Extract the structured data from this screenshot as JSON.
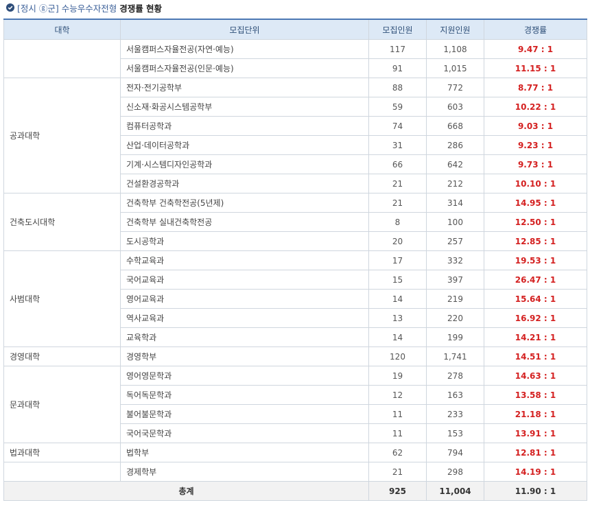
{
  "title": {
    "prefix": "[정시 ⓖ군] 수능우수자전형",
    "main": "경쟁률 현황"
  },
  "headers": [
    "대학",
    "모집단위",
    "모집인원",
    "지원인원",
    "경쟁률"
  ],
  "groups": [
    {
      "college": "",
      "rows": [
        {
          "unit": "서울캠퍼스자율전공(자연·예능)",
          "quota": "117",
          "applicants": "1,108",
          "rate": "9.47 : 1"
        },
        {
          "unit": "서울캠퍼스자율전공(인문·예능)",
          "quota": "91",
          "applicants": "1,015",
          "rate": "11.15 : 1"
        }
      ]
    },
    {
      "college": "공과대학",
      "rows": [
        {
          "unit": "전자·전기공학부",
          "quota": "88",
          "applicants": "772",
          "rate": "8.77 : 1"
        },
        {
          "unit": "신소재·화공시스템공학부",
          "quota": "59",
          "applicants": "603",
          "rate": "10.22 : 1"
        },
        {
          "unit": "컴퓨터공학과",
          "quota": "74",
          "applicants": "668",
          "rate": "9.03 : 1"
        },
        {
          "unit": "산업·데이터공학과",
          "quota": "31",
          "applicants": "286",
          "rate": "9.23 : 1"
        },
        {
          "unit": "기계·시스템디자인공학과",
          "quota": "66",
          "applicants": "642",
          "rate": "9.73 : 1"
        },
        {
          "unit": "건설환경공학과",
          "quota": "21",
          "applicants": "212",
          "rate": "10.10 : 1"
        }
      ]
    },
    {
      "college": "건축도시대학",
      "rows": [
        {
          "unit": "건축학부 건축학전공(5년제)",
          "quota": "21",
          "applicants": "314",
          "rate": "14.95 : 1"
        },
        {
          "unit": "건축학부 실내건축학전공",
          "quota": "8",
          "applicants": "100",
          "rate": "12.50 : 1"
        },
        {
          "unit": "도시공학과",
          "quota": "20",
          "applicants": "257",
          "rate": "12.85 : 1"
        }
      ]
    },
    {
      "college": "사범대학",
      "rows": [
        {
          "unit": "수학교육과",
          "quota": "17",
          "applicants": "332",
          "rate": "19.53 : 1"
        },
        {
          "unit": "국어교육과",
          "quota": "15",
          "applicants": "397",
          "rate": "26.47 : 1"
        },
        {
          "unit": "영어교육과",
          "quota": "14",
          "applicants": "219",
          "rate": "15.64 : 1"
        },
        {
          "unit": "역사교육과",
          "quota": "13",
          "applicants": "220",
          "rate": "16.92 : 1"
        },
        {
          "unit": "교육학과",
          "quota": "14",
          "applicants": "199",
          "rate": "14.21 : 1"
        }
      ]
    },
    {
      "college": "경영대학",
      "rows": [
        {
          "unit": "경영학부",
          "quota": "120",
          "applicants": "1,741",
          "rate": "14.51 : 1"
        }
      ]
    },
    {
      "college": "문과대학",
      "rows": [
        {
          "unit": "영어영문학과",
          "quota": "19",
          "applicants": "278",
          "rate": "14.63 : 1"
        },
        {
          "unit": "독어독문학과",
          "quota": "12",
          "applicants": "163",
          "rate": "13.58 : 1"
        },
        {
          "unit": "불어불문학과",
          "quota": "11",
          "applicants": "233",
          "rate": "21.18 : 1"
        },
        {
          "unit": "국어국문학과",
          "quota": "11",
          "applicants": "153",
          "rate": "13.91 : 1"
        }
      ]
    },
    {
      "college": "법과대학",
      "rows": [
        {
          "unit": "법학부",
          "quota": "62",
          "applicants": "794",
          "rate": "12.81 : 1"
        }
      ]
    },
    {
      "college": "",
      "rows": [
        {
          "unit": "경제학부",
          "quota": "21",
          "applicants": "298",
          "rate": "14.19 : 1"
        }
      ]
    }
  ],
  "total": {
    "label": "총계",
    "quota": "925",
    "applicants": "11,004",
    "rate": "11.90 : 1"
  },
  "colors": {
    "accent": "#3a5f98",
    "header_bg": "#dde9f6",
    "rate": "#d42020",
    "border": "#cfd6de"
  }
}
